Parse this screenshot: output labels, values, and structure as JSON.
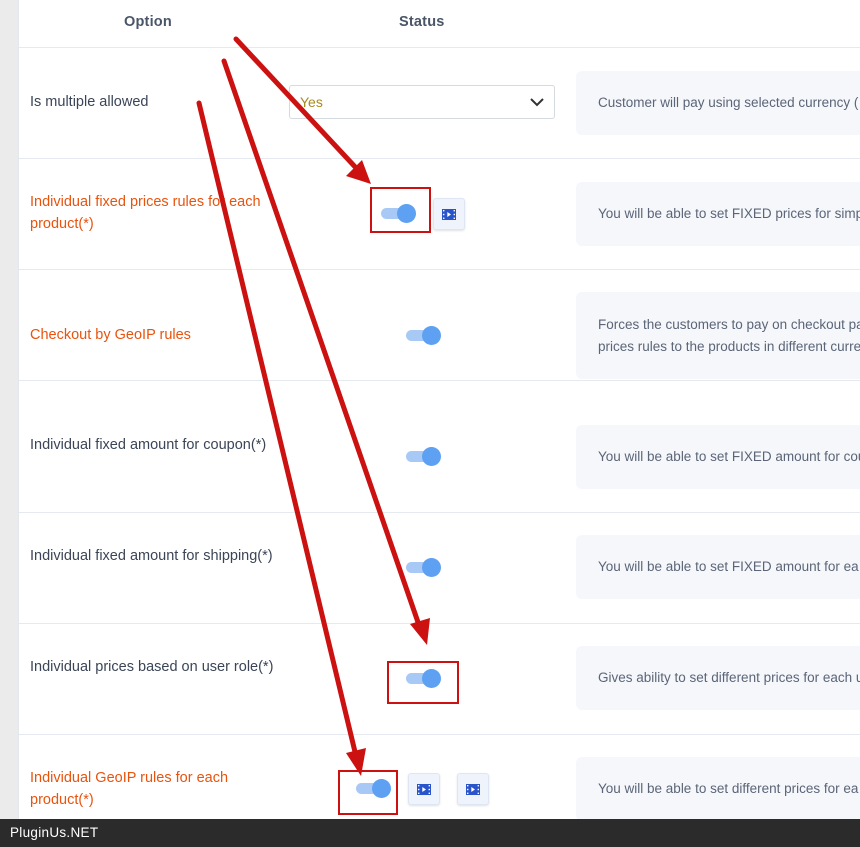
{
  "header": {
    "option": "Option",
    "status": "Status"
  },
  "rows": [
    {
      "label": "Is multiple allowed",
      "highlighted": false,
      "control": "select",
      "select_value": "Yes",
      "description": "Customer will pay using selected currency ("
    },
    {
      "label": "Individual fixed prices rules for each product(*)",
      "highlighted": true,
      "control": "toggle",
      "toggle_on": true,
      "video_buttons": 1,
      "description": "You will be able to set FIXED prices for simp"
    },
    {
      "label": "Checkout by GeoIP rules",
      "highlighted": true,
      "control": "toggle",
      "toggle_on": true,
      "description_line1": "Forces the customers to pay on checkout pa",
      "description_line2": "prices rules to the products in different curre"
    },
    {
      "label": "Individual fixed amount for coupon(*)",
      "highlighted": false,
      "control": "toggle",
      "toggle_on": true,
      "description": "You will be able to set FIXED amount for cou"
    },
    {
      "label": "Individual fixed amount for shipping(*)",
      "highlighted": false,
      "control": "toggle",
      "toggle_on": true,
      "description": "You will be able to set FIXED amount for ea"
    },
    {
      "label": "Individual prices based on user role(*)",
      "highlighted": false,
      "control": "toggle",
      "toggle_on": true,
      "description": "Gives ability to set different prices for each u"
    },
    {
      "label": "Individual GeoIP rules for each product(*)",
      "highlighted": true,
      "control": "toggle",
      "toggle_on": true,
      "video_buttons": 2,
      "description": "You will be able to set different prices for ea"
    }
  ],
  "colors": {
    "highlight_label": "#e8530e",
    "toggle_knob": "#5ea1f2",
    "annotation_red": "#cc1111",
    "select_value": "#a9881d"
  },
  "footer": {
    "watermark": "PluginUs.NET"
  }
}
